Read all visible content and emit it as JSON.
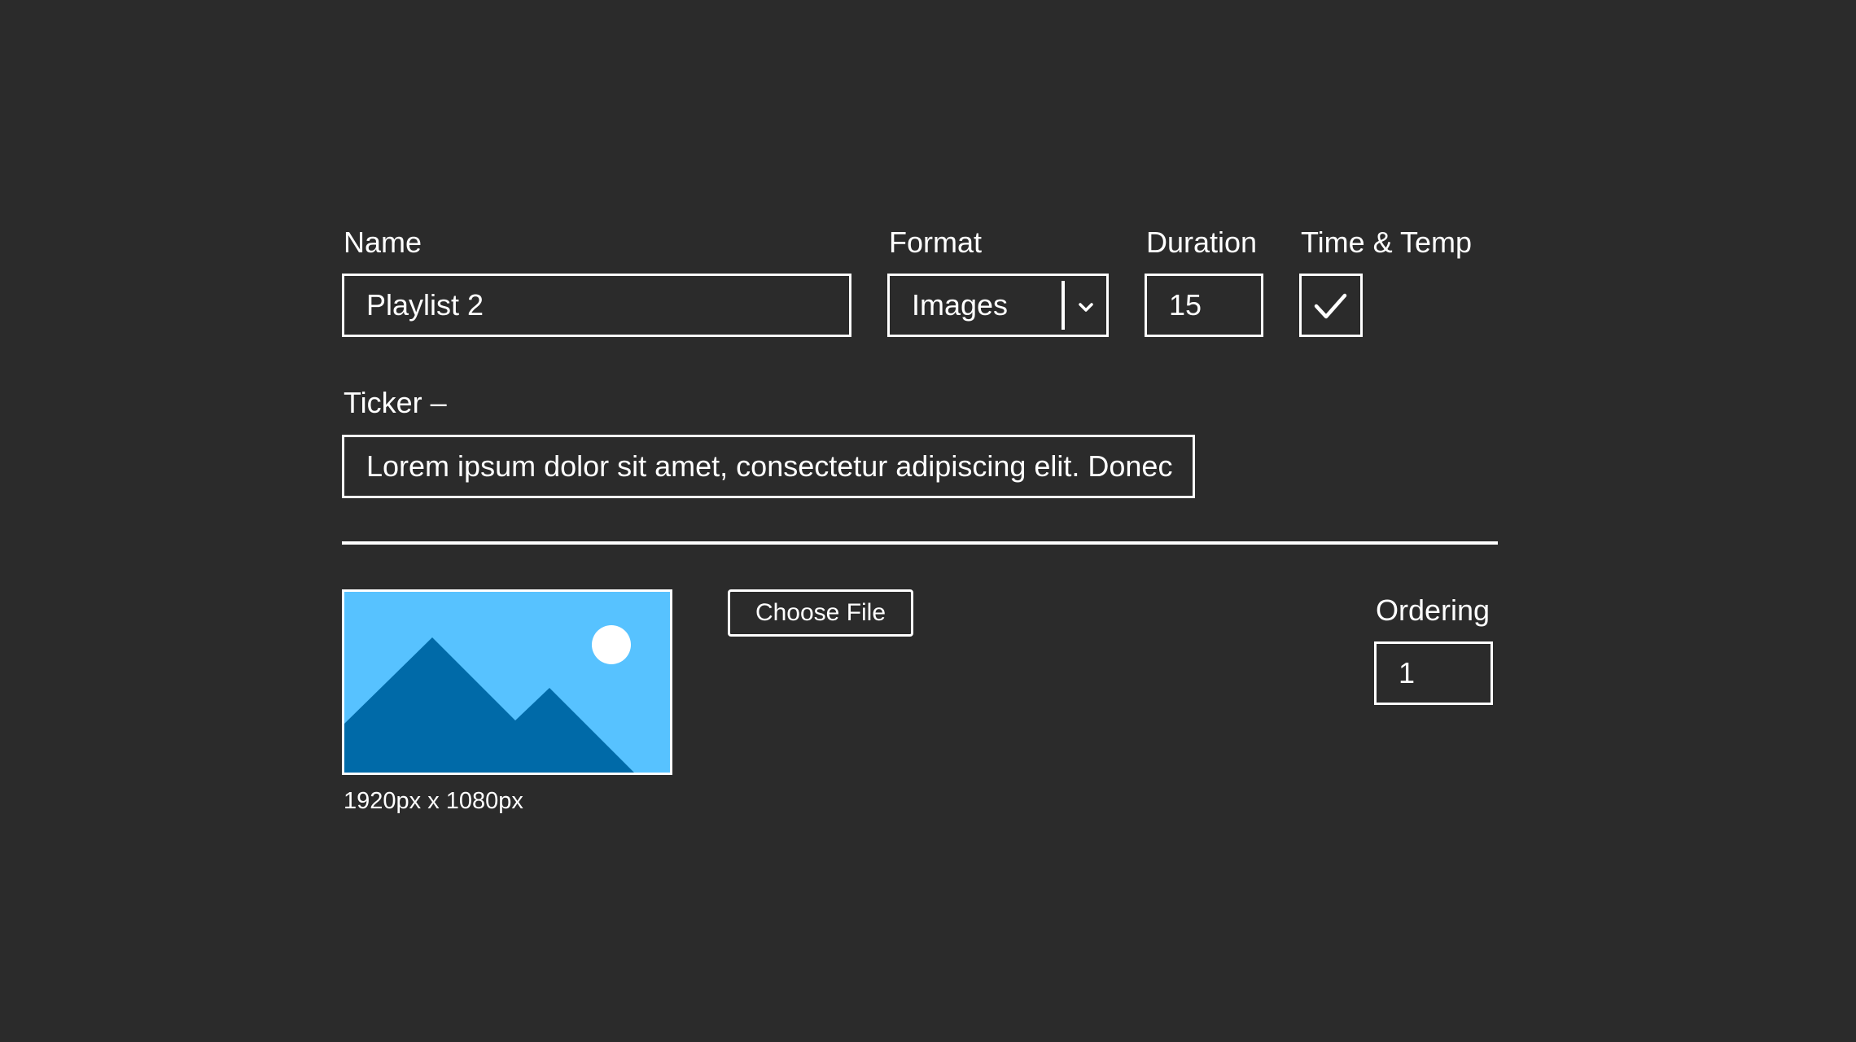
{
  "form": {
    "name_label": "Name",
    "name_value": "Playlist 2",
    "format_label": "Format",
    "format_value": "Images",
    "duration_label": "Duration",
    "duration_value": "15",
    "time_temp_label": "Time & Temp",
    "time_temp_checked": true,
    "ticker_label": "Ticker –",
    "ticker_value": "Lorem ipsum dolor sit amet, consectetur adipiscing elit. Donec"
  },
  "media": {
    "image_caption": "1920px x 1080px",
    "choose_file_label": "Choose File",
    "ordering_label": "Ordering",
    "ordering_value": "1",
    "image_icon": "image-placeholder-icon"
  },
  "colors": {
    "background": "#2b2b2b",
    "foreground": "#ffffff",
    "sky": "#57c2ff",
    "mountain": "#006aa8"
  }
}
